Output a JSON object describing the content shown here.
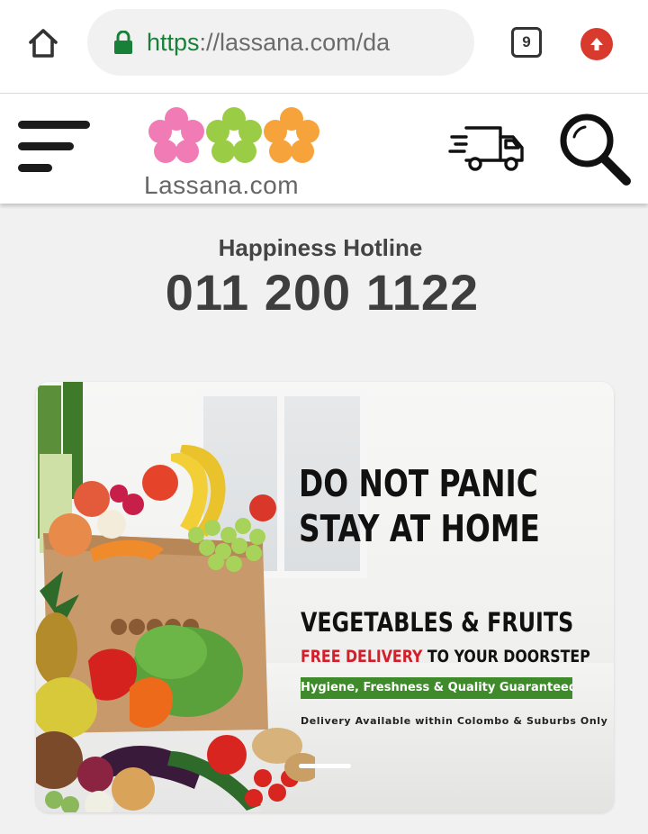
{
  "browser": {
    "url_scheme": "https",
    "url_rest": "://lassana.com/da",
    "tab_count": "9",
    "icons": [
      "home-icon",
      "lock-icon",
      "tabs-icon",
      "update-arrow-icon"
    ],
    "colors": {
      "url_scheme": "#188038",
      "update_badge": "#d83b2e"
    }
  },
  "header": {
    "logo_text": "Lassana.com",
    "icons": [
      "menu-icon",
      "delivery-truck-icon",
      "search-icon"
    ],
    "logo_colors": [
      "#f17bb5",
      "#9bcc45",
      "#f7a33c"
    ]
  },
  "hotline": {
    "label": "Happiness Hotline",
    "number": "011 200 1122"
  },
  "banner": {
    "headline_line1": "DO NOT PANIC",
    "headline_line2": "STAY AT HOME",
    "subhead": "VEGETABLES & FRUITS",
    "delivery_highlight": "FREE DELIVERY",
    "delivery_rest": " TO YOUR DOORSTEP",
    "quality_badge": "Hygiene, Freshness & Quality Guaranteed",
    "area_note": "Delivery Available within Colombo & Suburbs Only",
    "colors": {
      "highlight_red": "#d31f2b",
      "badge_green": "#3f8b2b"
    }
  }
}
